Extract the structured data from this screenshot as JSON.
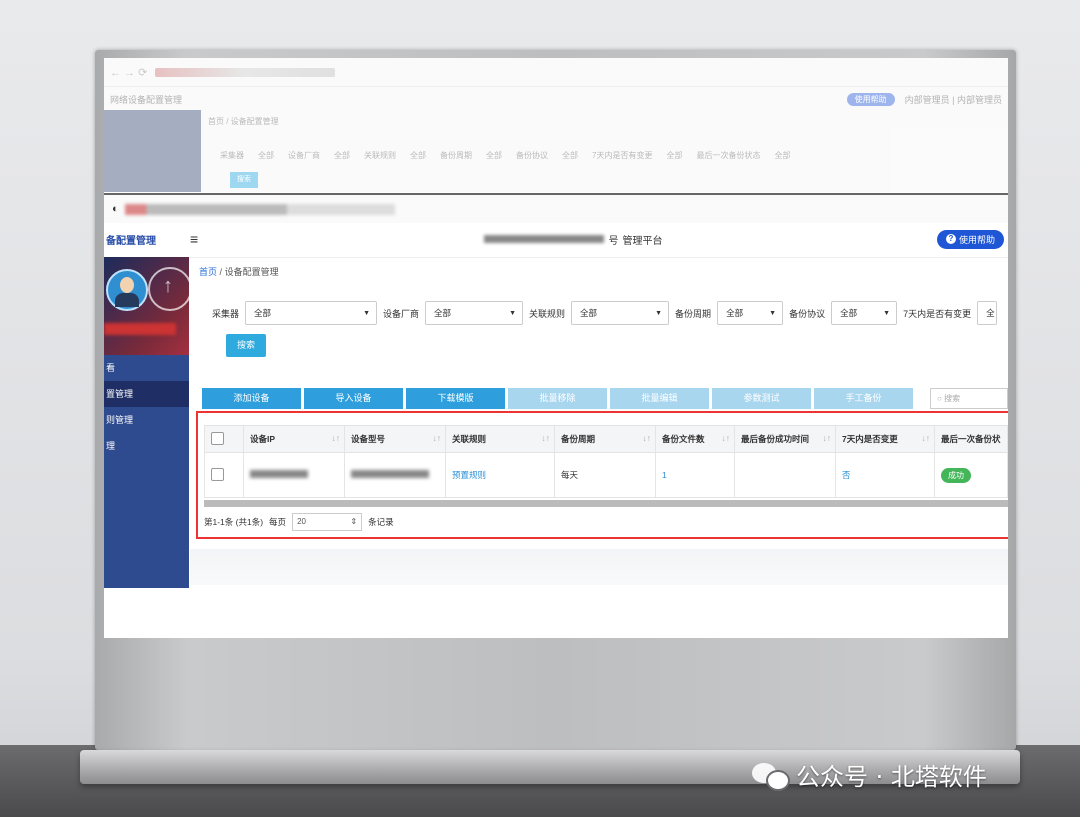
{
  "ghost": {
    "system_name": "网络设备配置管理",
    "help": "使用帮助",
    "breadcrumb": "首页 / 设备配置管理",
    "filters": [
      "采集器",
      "全部",
      "设备厂商",
      "全部",
      "关联规则",
      "全部",
      "备份周期",
      "全部",
      "备份协议",
      "全部",
      "7天内是否有变更",
      "全部",
      "最后一次备份状态",
      "全部"
    ],
    "search": "搜索",
    "right_links": "内部管理员 | 内部管理员"
  },
  "header": {
    "brand": "备配置管理",
    "title_suffix": "管理平台",
    "title_fragment": "号",
    "help_label": "使用帮助"
  },
  "sidebar": {
    "items": [
      {
        "label": "看"
      },
      {
        "label": "置管理"
      },
      {
        "label": "则管理"
      },
      {
        "label": "理"
      }
    ]
  },
  "breadcrumb": {
    "home": "首页",
    "sep": "/",
    "current": "设备配置管理"
  },
  "filters": [
    {
      "label": "采集器",
      "value": "全部"
    },
    {
      "label": "设备厂商",
      "value": "全部"
    },
    {
      "label": "关联规则",
      "value": "全部"
    },
    {
      "label": "备份周期",
      "value": "全部"
    },
    {
      "label": "备份协议",
      "value": "全部"
    },
    {
      "label": "7天内是否有变更",
      "value": "全"
    }
  ],
  "search_button": "搜索",
  "toolbar": {
    "buttons": [
      "添加设备",
      "导入设备",
      "下载模版",
      "批量移除",
      "批量编辑",
      "参数测试",
      "手工备份"
    ],
    "search_placeholder": "搜索"
  },
  "table": {
    "columns": [
      "设备IP",
      "设备型号",
      "关联规则",
      "备份周期",
      "备份文件数",
      "最后备份成功时间",
      "7天内是否变更",
      "最后一次备份状"
    ],
    "rows": [
      {
        "ip": "",
        "model": "",
        "rule": "预置规则",
        "cycle": "每天",
        "files": "1",
        "last_success": "",
        "changed": "否",
        "status": "成功"
      }
    ]
  },
  "pager": {
    "summary": "第1-1条 (共1条)",
    "per_page_label": "每页",
    "per_page": "20",
    "suffix": "条记录"
  },
  "watermark": {
    "text": "公众号 · 北塔软件"
  },
  "colors": {
    "primary": "#2e9fdc",
    "sidebar": "#2f4b8f",
    "highlight": "#e33",
    "success": "#44b65a",
    "help": "#1f56d6"
  }
}
